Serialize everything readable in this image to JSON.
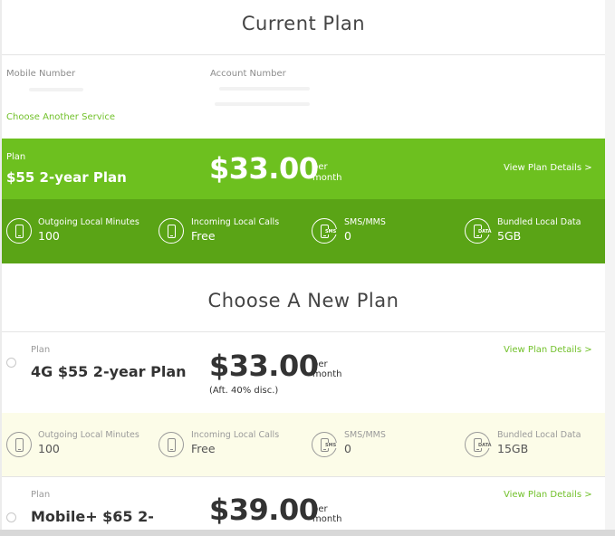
{
  "current": {
    "title": "Current Plan",
    "mobile_label": "Mobile Number",
    "account_label": "Account Number",
    "choose_service": "Choose Another Service",
    "plan_label": "Plan",
    "plan_name": "$55 2-year Plan",
    "price": "$33.00",
    "per": "per",
    "month": "month",
    "view_details": "View Plan Details >",
    "features": [
      {
        "title": "Outgoing Local Minutes",
        "value": "100",
        "icon": "phone-icon"
      },
      {
        "title": "Incoming Local Calls",
        "value": "Free",
        "icon": "phone-icon"
      },
      {
        "title": "SMS/MMS",
        "value": "0",
        "icon": "sms-icon",
        "tag": "SMS"
      },
      {
        "title": "Bundled Local Data",
        "value": "5GB",
        "icon": "data-icon",
        "tag": "DATA"
      }
    ]
  },
  "new_plans": {
    "title": "Choose A New Plan",
    "items": [
      {
        "plan_label": "Plan",
        "name": "4G $55 2-year Plan",
        "price": "$33.00",
        "per": "per",
        "month": "month",
        "discount": "(Aft. 40% disc.)",
        "view_details": "View Plan Details >",
        "features": [
          {
            "title": "Outgoing Local Minutes",
            "value": "100"
          },
          {
            "title": "Incoming Local Calls",
            "value": "Free"
          },
          {
            "title": "SMS/MMS",
            "value": "0",
            "tag": "SMS"
          },
          {
            "title": "Bundled Local Data",
            "value": "15GB",
            "tag": "DATA"
          }
        ]
      },
      {
        "plan_label": "Plan",
        "name": "Mobile+ $65 2-",
        "price": "$39.00",
        "per": "per",
        "month": "month",
        "view_details": "View Plan Details >"
      }
    ]
  },
  "colors": {
    "accent_green": "#6dc01f",
    "dark_green": "#5aa416",
    "link_green": "#72c12b",
    "highlight_bg": "#fcfce8"
  }
}
